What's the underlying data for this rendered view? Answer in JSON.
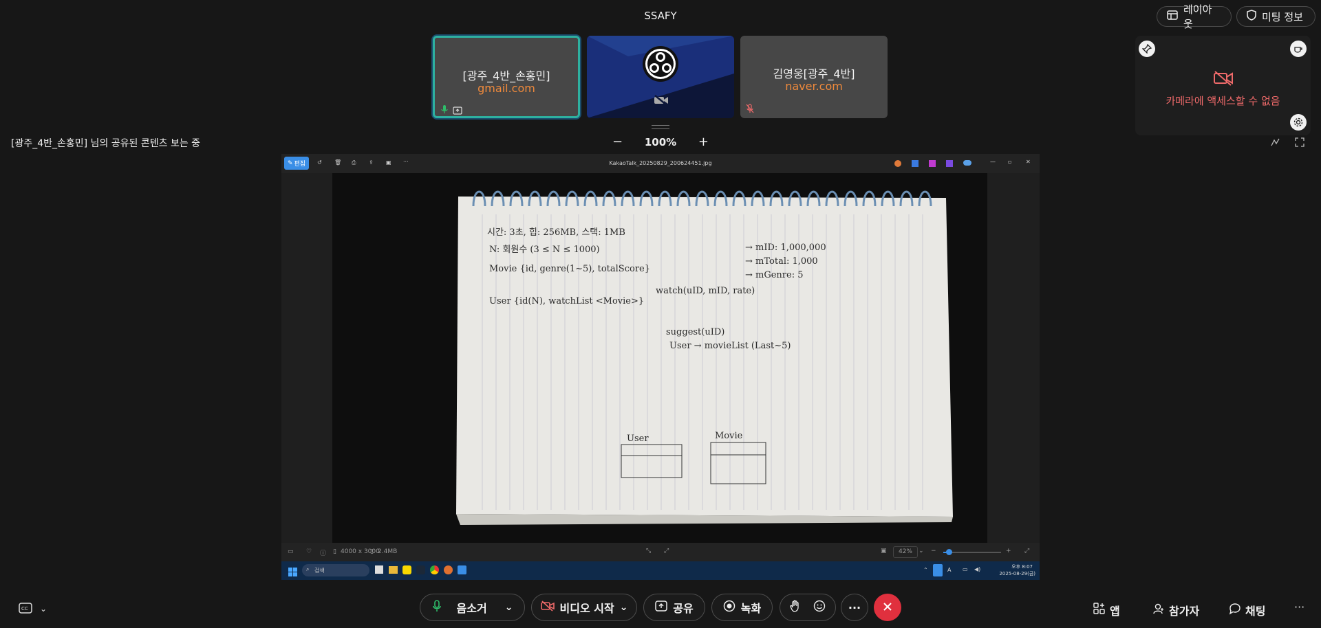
{
  "header": {
    "title": "SSAFY",
    "layout_label": "레이아웃",
    "meeting_info_label": "미팅 정보"
  },
  "tiles": [
    {
      "name": "[광주_4반_손홍민]",
      "email": "gmail.com"
    },
    {
      "name": "",
      "email": ""
    },
    {
      "name": "김영웅[광주_4반]",
      "email": "naver.com"
    }
  ],
  "self_preview": {
    "message": "카메라에 액세스할 수 없음"
  },
  "viewing": {
    "text": "[광주_4반_손홍민] 님의 공유된 콘텐츠 보는 중"
  },
  "zoom": {
    "minus": "−",
    "value": "100%",
    "plus": "+"
  },
  "photo_viewer": {
    "edit_label": "편집",
    "file_name": "KakaoTalk_20250829_200624451.jpg",
    "dimensions": "4000 x 3000",
    "file_size": "2.4MB",
    "zoom_percent": "42%",
    "zoom_slider_level": 0.1
  },
  "taskbar": {
    "search_placeholder": "검색",
    "time": "오후 8:07",
    "date": "2025-08-29(금)",
    "ime": "A"
  },
  "notes": {
    "line1": "시간: 3초, 힙: 256MB, 스택: 1MB",
    "line2": "N: 회원수 (3 ≤ N ≤ 1000)",
    "line3": "Movie {id, genre(1~5), totalScore}",
    "line4": "User {id(N), watchList <Movie>}",
    "line5": "watch(uID, mID, rate)",
    "line6": "suggest(uID)",
    "line7": "User → movieList (Last~5)",
    "right1": "→ mID: 1,000,000",
    "right2": "→ mTotal: 1,000",
    "right3": "→ mGenre: 5",
    "user_box": "User",
    "movie_box": "Movie"
  },
  "controls": {
    "mute_label": "음소거",
    "video_label": "비디오 시작",
    "share_label": "공유",
    "record_label": "녹화",
    "apps_label": "앱",
    "participants_label": "참가자",
    "chat_label": "채팅"
  },
  "colors": {
    "accent_teal": "#2eb0a0",
    "email_orange": "#f08a3c",
    "warning_red": "#ef6a6a",
    "leave_red": "#e0303e",
    "mic_green": "#2ebd6a"
  },
  "icons": [
    "layout-icon",
    "shield-icon",
    "pin-icon",
    "cup-icon",
    "camera-off-icon",
    "settings-icon",
    "mic-icon",
    "video-off-icon",
    "share-icon",
    "record-icon",
    "hand-icon",
    "emoji-icon",
    "more-icon",
    "leave-icon",
    "apps-icon",
    "participants-icon",
    "chat-icon",
    "caption-icon"
  ]
}
